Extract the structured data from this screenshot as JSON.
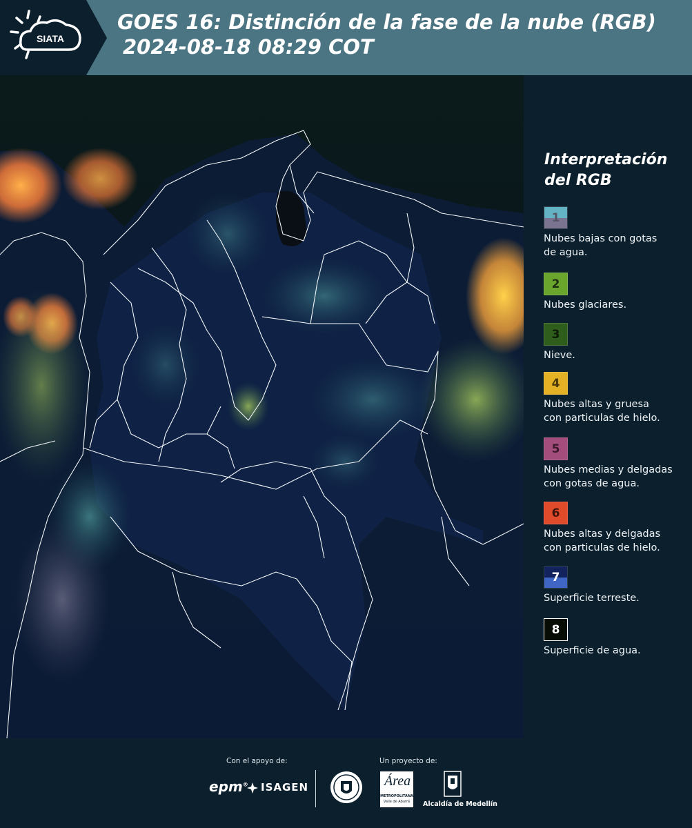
{
  "header": {
    "brand": "SIATA",
    "title_line1": "GOES 16: Distinción de la fase de la nube (RGB)",
    "title_line2": "2024-08-18 08:29 COT",
    "background_color": "#4b7582",
    "logo_icon": "sun-cloud-icon"
  },
  "legend": {
    "title": "Interpretación\ndel RGB",
    "items": [
      {
        "num": "1",
        "label": "Nubes bajas con gotas\nde agua.",
        "color_top": "#63b3c4",
        "color_bottom": "#7a7490",
        "num_color": "#555566"
      },
      {
        "num": "2",
        "label": "Nubes glaciares.",
        "color_top": "#6aa52e",
        "color_bottom": "#6aa52e",
        "num_color": "#1e2e10"
      },
      {
        "num": "3",
        "label": "Nieve.",
        "color_top": "#2f5d1c",
        "color_bottom": "#2f5d1c",
        "num_color": "#0c1a06"
      },
      {
        "num": "4",
        "label": "Nubes altas y gruesa\ncon particulas de hielo.",
        "color_top": "#e4b024",
        "color_bottom": "#e4b024",
        "num_color": "#4a3a08"
      },
      {
        "num": "5",
        "label": "Nubes medias y delgadas\ncon gotas de agua.",
        "color_top": "#a24d7c",
        "color_bottom": "#a24d7c",
        "num_color": "#3a1a2c"
      },
      {
        "num": "6",
        "label": "Nubes altas y delgadas\ncon particulas de hielo.",
        "color_top": "#e04b2c",
        "color_bottom": "#e04b2c",
        "num_color": "#3e120a"
      },
      {
        "num": "7",
        "label": "Superficie terreste.",
        "color_top": "#12235e",
        "color_bottom": "#3f66c4",
        "num_color": "#ffffff"
      },
      {
        "num": "8",
        "label": "Superficie de agua.",
        "color_top": "#070d05",
        "color_bottom": "#070d05",
        "num_color": "#ffffff"
      }
    ]
  },
  "footer": {
    "support_label": "Con el apoyo de:",
    "project_label": "Un proyecto de:",
    "epm": "epm",
    "isagen": "ISAGEN",
    "area_metro": "Área",
    "area_metro_sub": "METROPOLITANA",
    "area_metro_sub2": "Valle de Aburrá",
    "alcaldia": "Alcaldía de Medellín"
  }
}
